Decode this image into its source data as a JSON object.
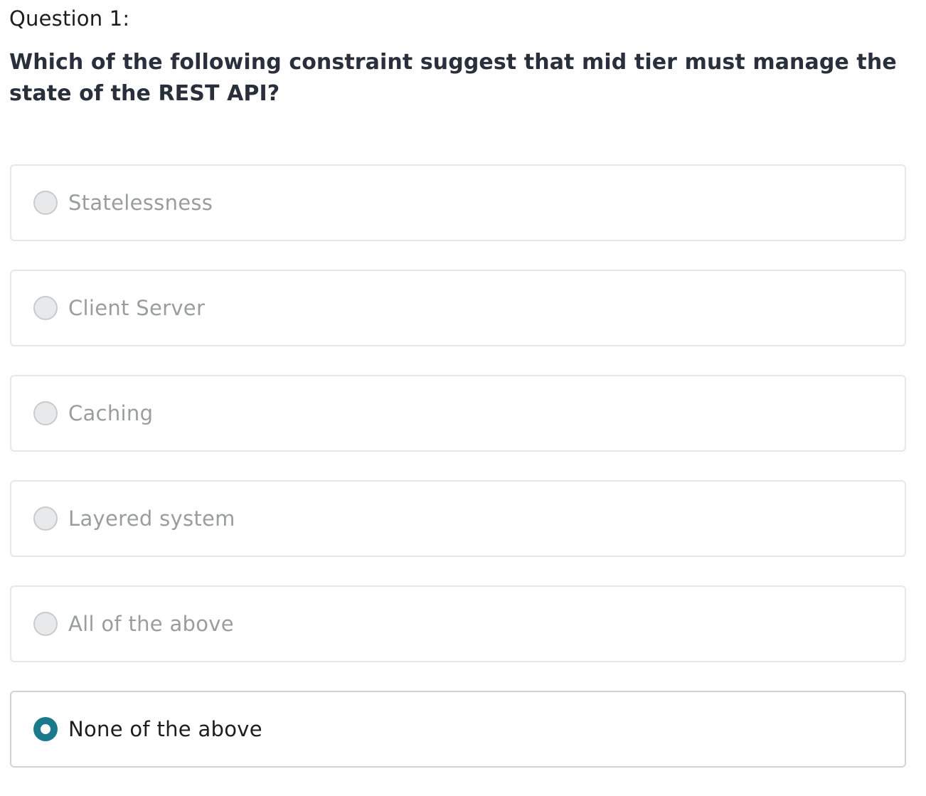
{
  "question": {
    "number_label": "Question 1:",
    "text": "Which of the following constraint suggest that mid tier must manage the state of the REST API?"
  },
  "options": [
    {
      "label": "Statelessness",
      "selected": false
    },
    {
      "label": "Client Server",
      "selected": false
    },
    {
      "label": "Caching",
      "selected": false
    },
    {
      "label": "Layered system",
      "selected": false
    },
    {
      "label": "All of the above",
      "selected": false
    },
    {
      "label": "None of the above",
      "selected": true
    }
  ],
  "colors": {
    "accent": "#1a7a8c",
    "unselected_text": "#9a9ca0",
    "selected_text": "#1c1d1f",
    "border": "#e6e7e8"
  }
}
